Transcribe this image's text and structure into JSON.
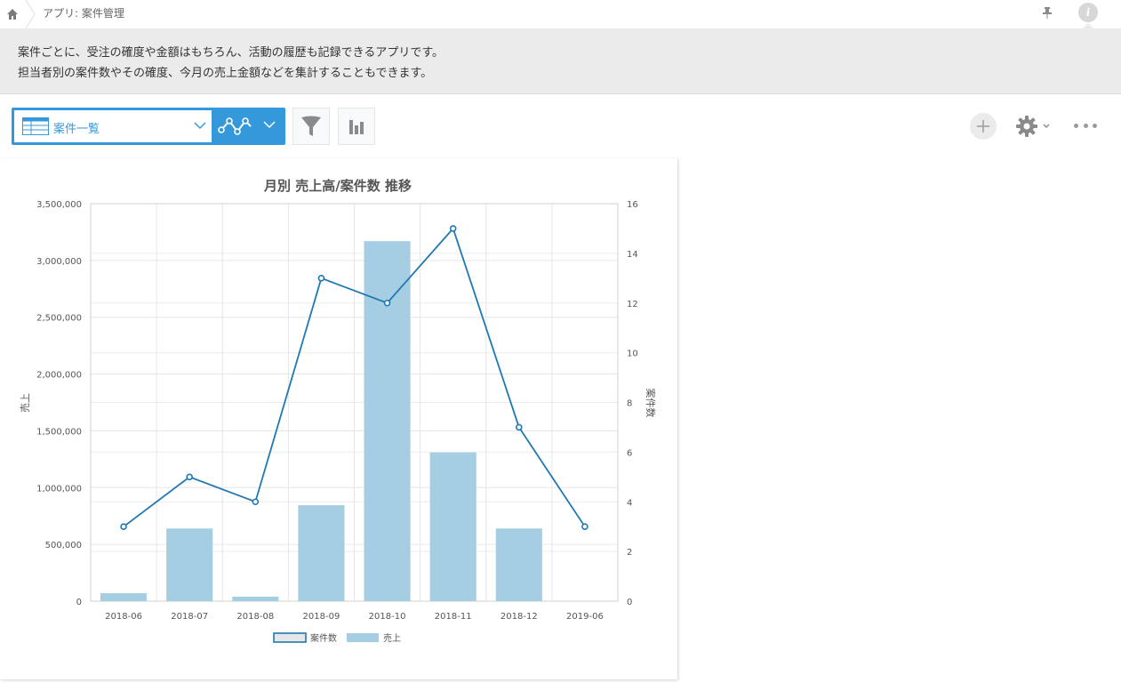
{
  "breadcrumb": {
    "app_label": "アプリ: 案件管理"
  },
  "description": {
    "line1": "案件ごとに、受注の確度や金額はもちろん、活動の履歴も記録できるアプリです。",
    "line2": "担当者別の案件数やその確度、今月の売上金額などを集計することもできます。"
  },
  "toolbar": {
    "view_name": "案件一覧",
    "icons": [
      "home-icon",
      "pin-icon",
      "info-icon",
      "table-icon",
      "chevron-down-icon",
      "line-chart-icon",
      "filter-icon",
      "bar-chart-icon",
      "plus-icon",
      "gear-icon",
      "more-icon"
    ]
  },
  "colors": {
    "accent": "#3498db",
    "bar": "#a6cee3",
    "line": "#1f78b4"
  },
  "chart_data": {
    "type": "bar",
    "title": "月別 売上高/案件数 推移",
    "categories": [
      "2018-06",
      "2018-07",
      "2018-08",
      "2018-09",
      "2018-10",
      "2018-11",
      "2018-12",
      "2019-06"
    ],
    "series": [
      {
        "name": "売上",
        "type": "bar",
        "axis": "left",
        "values": [
          70000,
          640000,
          40000,
          845000,
          3170000,
          1310000,
          640000,
          0
        ]
      },
      {
        "name": "案件数",
        "type": "line",
        "axis": "right",
        "values": [
          3,
          5,
          4,
          13,
          12,
          15,
          7,
          3
        ]
      }
    ],
    "ylabel": "売上",
    "y2label": "案件数",
    "ylim": [
      0,
      3500000
    ],
    "y2lim": [
      0,
      16
    ],
    "yticks": [
      "0",
      "500,000",
      "1,000,000",
      "1,500,000",
      "2,000,000",
      "2,500,000",
      "3,000,000",
      "3,500,000"
    ],
    "y2ticks": [
      "0",
      "2",
      "4",
      "6",
      "8",
      "10",
      "12",
      "14",
      "16"
    ],
    "legend": [
      "案件数",
      "売上"
    ],
    "legend_position": "bottom",
    "grid": true
  }
}
